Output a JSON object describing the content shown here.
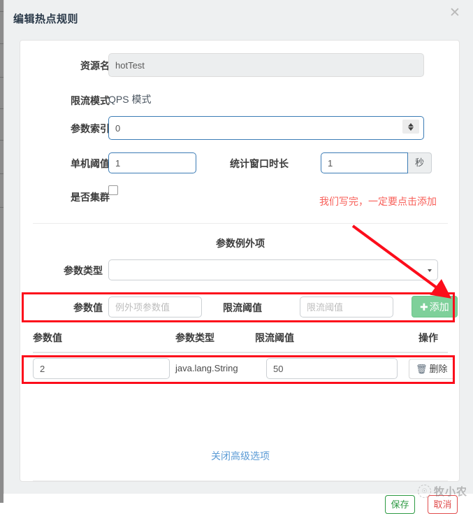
{
  "dialog": {
    "title": "编辑热点规则",
    "close_icon": "close-icon"
  },
  "fields": {
    "resource_name": {
      "label": "资源名",
      "value": "hotTest",
      "disabled": true
    },
    "flow_mode": {
      "label": "限流模式",
      "value": "QPS 模式"
    },
    "param_index": {
      "label": "参数索引",
      "value": "0",
      "spinner_icon": "spinner-up-down-icon"
    },
    "single_threshold": {
      "label": "单机阈值",
      "value": "1"
    },
    "window_duration": {
      "label": "统计窗口时长",
      "value": "1",
      "unit": "秒"
    },
    "is_cluster": {
      "label": "是否集群",
      "checked": false
    }
  },
  "annotation": {
    "text": "我们写完，一定要点击添加",
    "color": "#f8605a",
    "arrow_color": "#fc0d1b",
    "box_color": "#fc0d1b"
  },
  "exception_section": {
    "title": "参数例外项",
    "param_type": {
      "label": "参数类型",
      "value": "",
      "caret_icon": "chevron-down-icon"
    },
    "param_value": {
      "label": "参数值",
      "value": "",
      "placeholder": "例外项参数值"
    },
    "threshold": {
      "label": "限流阈值",
      "value": "",
      "placeholder": "限流阈值"
    },
    "add_button": {
      "label": "添加",
      "icon": "plus-icon",
      "color": "#7ed09a"
    }
  },
  "table": {
    "columns": [
      "参数值",
      "参数类型",
      "限流阈值",
      "操作"
    ],
    "rows": [
      {
        "param_value": "2",
        "param_type": "java.lang.String",
        "threshold": "50",
        "action_label": "删除",
        "action_icon": "trash-icon"
      }
    ]
  },
  "advanced_link": {
    "label": "关闭高级选项",
    "color": "#5b9bd5"
  },
  "footer": {
    "save_label": "保存",
    "cancel_label": "取消",
    "save_color": "#2d9a43",
    "cancel_color": "#e04c4c"
  },
  "watermark": {
    "text": "牧小农",
    "logo_icon": "circle-logo-icon"
  }
}
